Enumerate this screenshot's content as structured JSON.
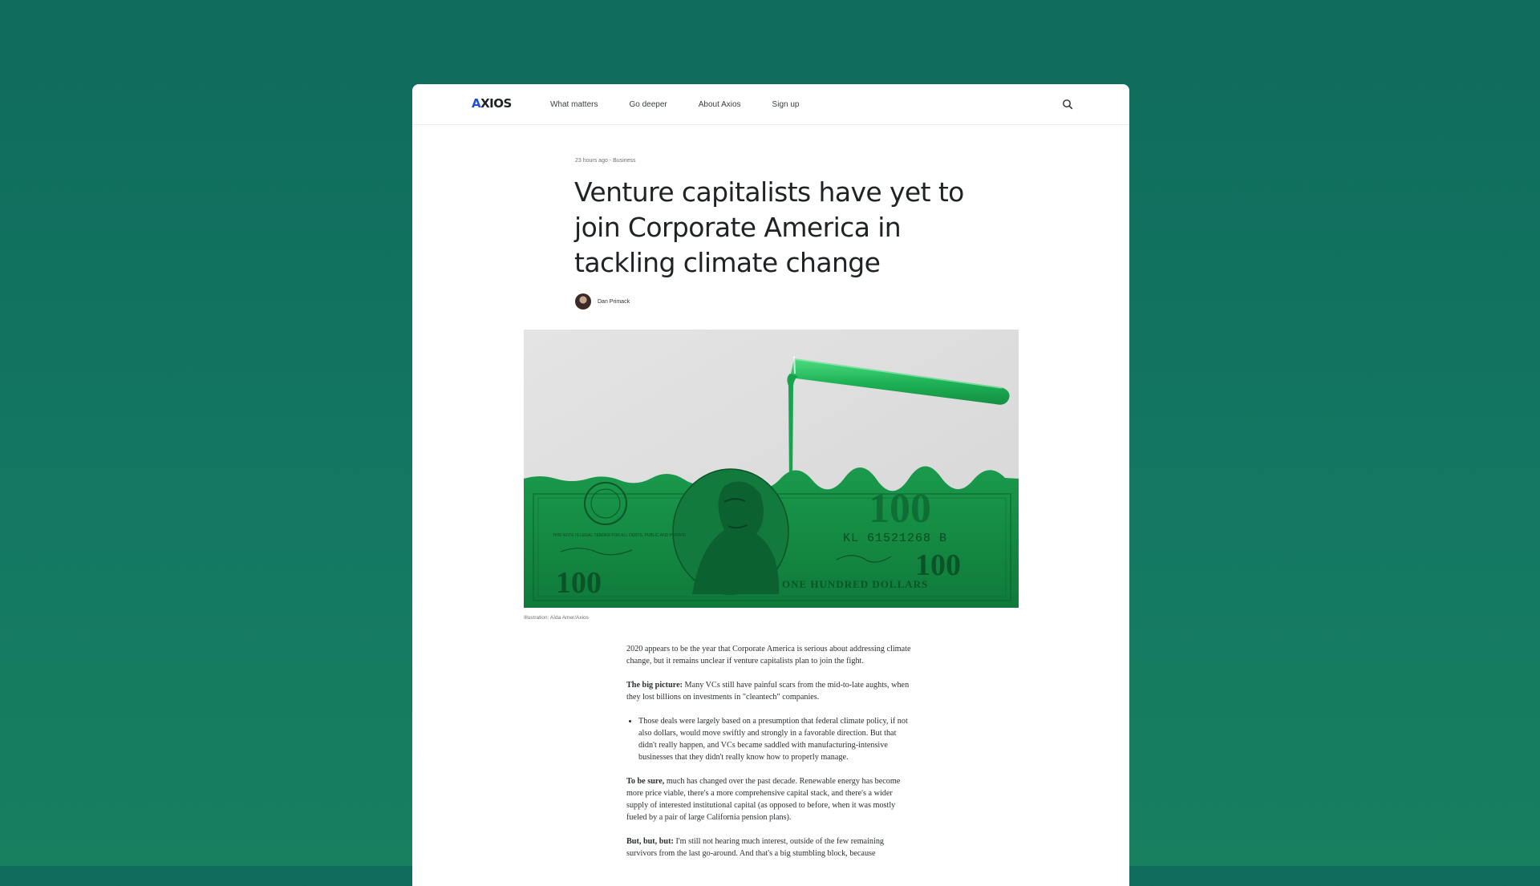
{
  "nav": {
    "logo": "AXIOS",
    "links": [
      "What matters",
      "Go deeper",
      "About Axios",
      "Sign up"
    ],
    "search_icon": "search-icon"
  },
  "article": {
    "meta": "23 hours ago - Business",
    "headline": "Venture capitalists have yet to join Corporate America in tackling climate change",
    "author": "Dan Primack",
    "image": {
      "serial": "KL 61521268 B",
      "denomination": "100",
      "banner": "ONE HUNDRED DOLLARS",
      "legal_tender_text": "THIS NOTE IS LEGAL TENDER FOR ALL DEBTS, PUBLIC AND PRIVATE"
    },
    "caption": "Illustration: Aïda Amer/Axios",
    "p1": "2020 appears to be the year that Corporate America is serious about addressing climate change, but it remains unclear if venture capitalists plan to join the fight.",
    "p2_lead": "The big picture:",
    "p2": " Many VCs still have painful scars from the mid-to-late aughts, when they lost billions on investments in \"cleantech\" companies.",
    "bullet1": "Those deals were largely based on a presumption that federal climate policy, if not also dollars, would move swiftly and strongly in a favorable direction. But that didn't really happen, and VCs became saddled with manufacturing-intensive businesses that they didn't really know how to properly manage.",
    "p3_lead": "To be sure,",
    "p3": " much has changed over the past decade. Renewable energy has become more price viable, there's a more comprehensive capital stack, and there's a wider supply of interested institutional capital (as opposed to before, when it was mostly fueled by a pair of large California pension plans).",
    "p4_lead": "But, but, but:",
    "p4": " I'm still not hearing much interest, outside of the few remaining survivors from the last go-around. And that's a big stumbling block, because"
  },
  "colors": {
    "background": "#137762",
    "accent_green": "#1fae55",
    "logo_slash": "#1f4ed8"
  }
}
